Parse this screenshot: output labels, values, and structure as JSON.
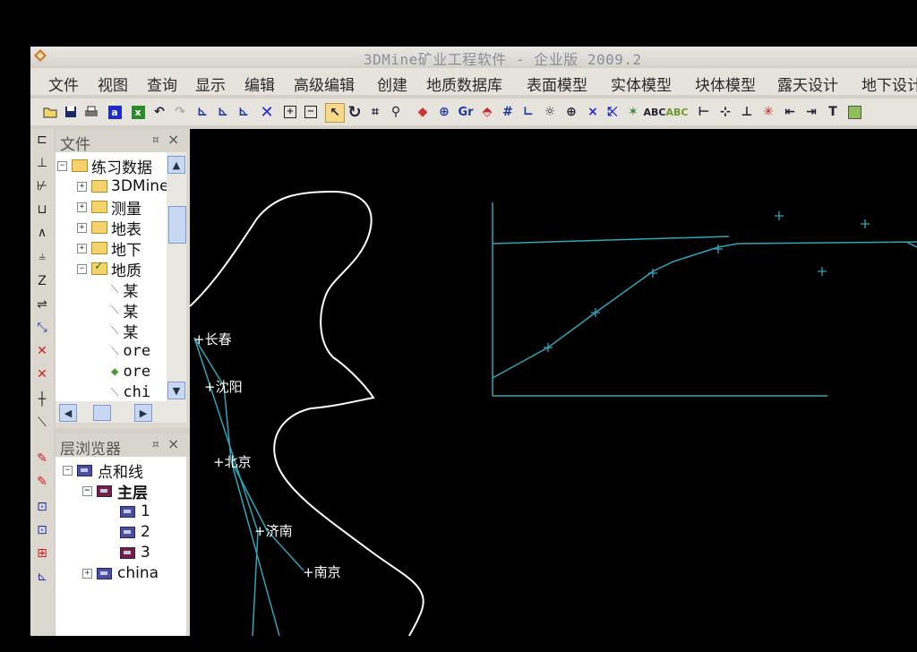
{
  "window": {
    "title": "3DMine矿业工程软件 - 企业版 2009.2"
  },
  "menu": [
    "文件",
    "视图",
    "查询",
    "显示",
    "编辑",
    "高级编辑",
    "创建",
    "地质数据库",
    "表面模型",
    "实体模型",
    "块体模型",
    "露天设计",
    "地下设计"
  ],
  "toolbar_icons": [
    "open-icon",
    "save-icon",
    "print-icon",
    "a-icon",
    "excel-icon",
    "undo-icon",
    "redo-icon",
    "polyline-icon",
    "polyline-edit-icon",
    "polyline-point-icon",
    "delete-icon",
    "zoom-in-box-icon",
    "zoom-out-box-icon",
    "select-arrow-icon",
    "rotate-icon",
    "zoom-extent-icon",
    "magnify-icon",
    "diamond-icon",
    "target-icon",
    "gr-icon",
    "section-icon",
    "grid-icon",
    "axis-icon",
    "light-icon",
    "crosshair-icon",
    "cross-icon",
    "point-add-icon",
    "point-star-icon",
    "bbc-icon",
    "abc-icon",
    "tick-left-icon",
    "tick-cross-icon",
    "tick-up-icon",
    "asterisk-icon",
    "arrow-left-icon",
    "arrow-right-icon",
    "t-icon",
    "fill-icon"
  ],
  "files_panel": {
    "title": "文件",
    "pin": "¤",
    "close": "×",
    "items": [
      {
        "label": "练习数据",
        "level": 0,
        "type": "folder",
        "expander": "−"
      },
      {
        "label": "3DMine",
        "level": 1,
        "type": "folder",
        "expander": "+"
      },
      {
        "label": "测量",
        "level": 1,
        "type": "folder",
        "expander": "+"
      },
      {
        "label": "地表",
        "level": 1,
        "type": "folder",
        "expander": "+"
      },
      {
        "label": "地下",
        "level": 1,
        "type": "folder",
        "expander": "+"
      },
      {
        "label": "地质",
        "level": 1,
        "type": "folder-checked",
        "expander": "−"
      },
      {
        "label": "某",
        "level": 2,
        "type": "file"
      },
      {
        "label": "某",
        "level": 2,
        "type": "file"
      },
      {
        "label": "某",
        "level": 2,
        "type": "file"
      },
      {
        "label": "ore",
        "level": 2,
        "type": "file"
      },
      {
        "label": "ore",
        "level": 2,
        "type": "diamond"
      },
      {
        "label": "chi",
        "level": 2,
        "type": "file"
      }
    ]
  },
  "layers_panel": {
    "title": "层浏览器",
    "pin": "¤",
    "close": "×",
    "items": [
      {
        "label": "点和线",
        "level": 0,
        "expander": "−",
        "bold": false
      },
      {
        "label": "主层",
        "level": 1,
        "expander": "−",
        "bold": true
      },
      {
        "label": "1",
        "level": 2,
        "bold": false
      },
      {
        "label": "2",
        "level": 2,
        "bold": false
      },
      {
        "label": "3",
        "level": 2,
        "bold": false
      },
      {
        "label": "china",
        "level": 1,
        "expander": "+",
        "bold": false
      }
    ]
  },
  "left_toolbar": [
    "rect-tool-icon",
    "line-tool-icon",
    "angle-tool-icon",
    "step-tool-icon",
    "caret-tool-icon",
    "comb-tool-icon",
    "z-tool-icon",
    "equal-tool-icon",
    "point-tool-icon",
    "cross-red-icon",
    "cross-red2-icon",
    "plus-tool-icon",
    "diag-tool-icon",
    "pencil-red-icon",
    "pencil-red2-icon",
    "box-edit-icon",
    "box-edit2-icon",
    "grid-red-icon",
    "axis-tool-icon"
  ],
  "canvas": {
    "cities": [
      "长春",
      "沈阳",
      "北京",
      "济南",
      "南京"
    ],
    "colors": {
      "coast": "#ffffff",
      "lines": "#2fa6b8"
    }
  }
}
